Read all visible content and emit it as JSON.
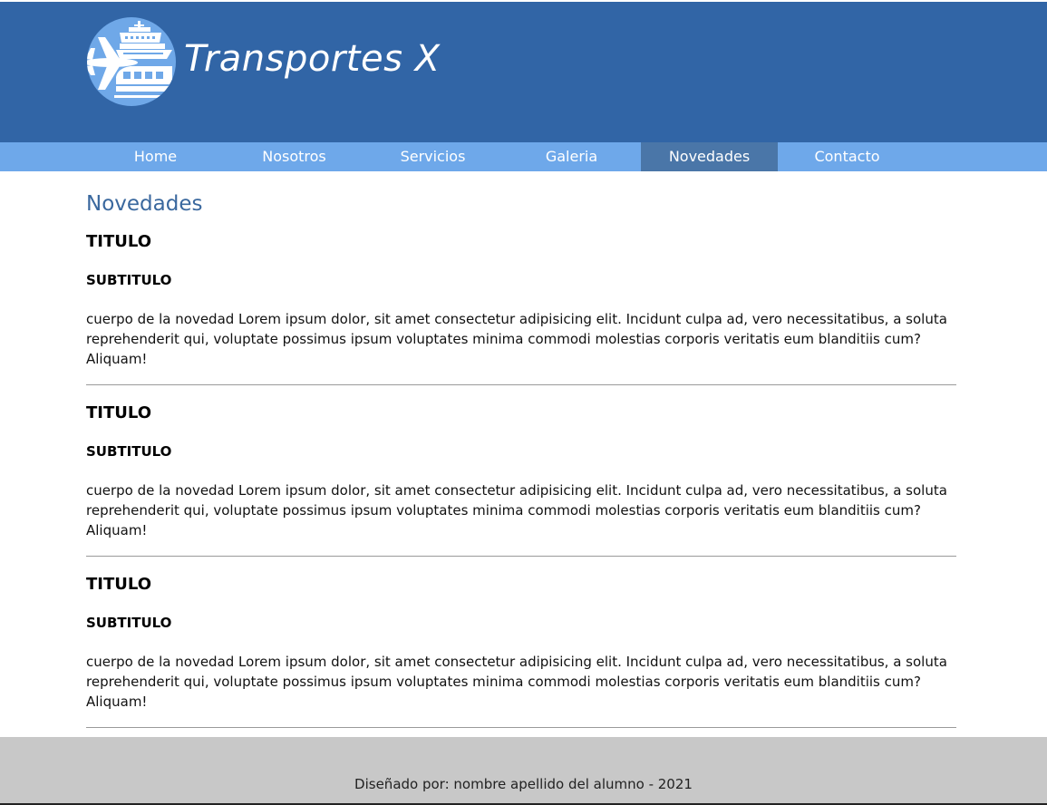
{
  "header": {
    "brand": "Transportes X",
    "logo_icon": "transport-logo-icon",
    "colors": {
      "header_bg": "#3165a6",
      "logo_bg": "#6fa8e8"
    }
  },
  "nav": {
    "items": [
      {
        "label": "Home",
        "active": false
      },
      {
        "label": "Nosotros",
        "active": false
      },
      {
        "label": "Servicios",
        "active": false
      },
      {
        "label": "Galeria",
        "active": false
      },
      {
        "label": "Novedades",
        "active": true
      },
      {
        "label": "Contacto",
        "active": false
      }
    ],
    "colors": {
      "bar_bg": "#6ea8ea",
      "active_bg": "#4a76a8"
    }
  },
  "main": {
    "title": "Novedades",
    "news": [
      {
        "title": "TITULO",
        "subtitle": "SUBTITULO",
        "body": "cuerpo de la novedad Lorem ipsum dolor, sit amet consectetur adipisicing elit. Incidunt culpa ad, vero necessitatibus, a soluta reprehenderit qui, voluptate possimus ipsum voluptates minima commodi molestias corporis veritatis eum blanditiis cum? Aliquam!"
      },
      {
        "title": "TITULO",
        "subtitle": "SUBTITULO",
        "body": "cuerpo de la novedad Lorem ipsum dolor, sit amet consectetur adipisicing elit. Incidunt culpa ad, vero necessitatibus, a soluta reprehenderit qui, voluptate possimus ipsum voluptates minima commodi molestias corporis veritatis eum blanditiis cum? Aliquam!"
      },
      {
        "title": "TITULO",
        "subtitle": "SUBTITULO",
        "body": "cuerpo de la novedad Lorem ipsum dolor, sit amet consectetur adipisicing elit. Incidunt culpa ad, vero necessitatibus, a soluta reprehenderit qui, voluptate possimus ipsum voluptates minima commodi molestias corporis veritatis eum blanditiis cum? Aliquam!"
      }
    ]
  },
  "footer": {
    "text": "Diseñado por: nombre apellido del alumno - 2021",
    "colors": {
      "footer_bg": "#c8c8c8"
    }
  }
}
